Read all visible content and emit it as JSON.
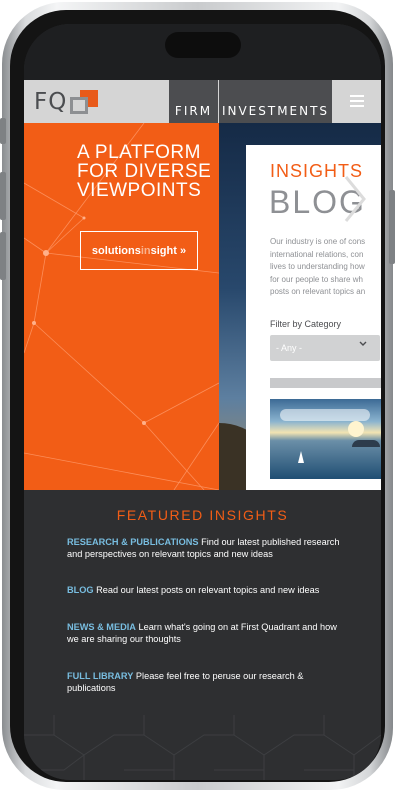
{
  "header": {
    "logo_text": "FQ",
    "nav": [
      "FIRM",
      "INVESTMENTS"
    ]
  },
  "hero": {
    "title_lines": [
      "A PLATFORM",
      "FOR DIVERSE",
      "VIEWPOINTS"
    ],
    "button": {
      "part1": "solutions",
      "part2": "in",
      "part3": "sight",
      "arrow": "»"
    }
  },
  "insights_card": {
    "label": "INSIGHTS",
    "title": "BLOG",
    "body_lines": [
      "Our industry is one of cons",
      "international relations, con",
      "lives to understanding how",
      "for our people to share wh",
      "posts on relevant topics an"
    ],
    "filter_label": "Filter by Category",
    "filter_value": "- Any -"
  },
  "featured": {
    "title": "FEATURED INSIGHTS",
    "items": [
      {
        "key": "RESEARCH & PUBLICATIONS",
        "text": "Find our latest published research and perspectives on relevant topics and new ideas"
      },
      {
        "key": "BLOG",
        "text": "Read our latest posts on relevant topics and new ideas"
      },
      {
        "key": "NEWS & MEDIA",
        "text": "Learn what's going on at First Quadrant and how we are sharing our thoughts"
      },
      {
        "key": "FULL LIBRARY",
        "text": "Please feel free to peruse our research & publications"
      }
    ]
  },
  "icons": {
    "menu": "hamburger-menu-icon",
    "caret": "chevron-down-icon",
    "arrow": "chevron-right-icon"
  },
  "colors": {
    "brand_orange": "#f25d16",
    "nav_dark": "#4c4d50",
    "link_blue": "#78bde0",
    "footer_dark": "#2e2f31"
  }
}
